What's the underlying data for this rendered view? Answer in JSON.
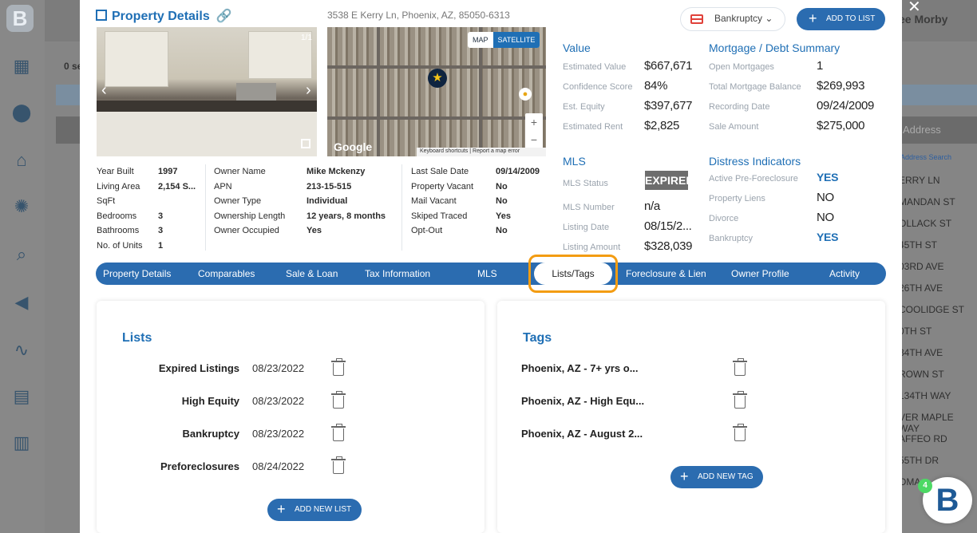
{
  "sidebar": {
    "logo": "B",
    "icons": [
      "grid-icon",
      "location-pin-icon",
      "home-icon",
      "lightbulb-icon",
      "home-search-icon",
      "megaphone-icon",
      "route-icon",
      "chat-icon",
      "bar-chart-icon"
    ]
  },
  "background": {
    "user_name": "ee Morby",
    "count_label": "0 se",
    "address_header": "Address",
    "address_search": "Address Search",
    "streets": [
      "ERRY LN",
      "MANDAN ST",
      "OLLACK ST",
      "45TH ST",
      "03RD AVE",
      "26TH AVE",
      "COOLIDGE ST",
      "0TH ST",
      "34TH AVE",
      "ROWN ST",
      "134TH WAY",
      "VER MAPLE WAY",
      "AFFEO RD",
      "55TH DR",
      "OMA"
    ]
  },
  "modal": {
    "title": "Property Details",
    "address": "3538 E Kerry Ln, Phoenix, AZ, 85050-6313",
    "status_select": "Bankruptcy",
    "add_to_list": "ADD TO LIST",
    "photo_counter": "1/1",
    "map": {
      "map_label": "MAP",
      "satellite_label": "SATELLITE",
      "google": "Google",
      "attribution": "Keyboard shortcuts  |  Report a map error"
    }
  },
  "facts": {
    "col1": [
      [
        "Year Built",
        "1997"
      ],
      [
        "Living Area",
        "2,154 S..."
      ],
      [
        "SqFt",
        ""
      ],
      [
        "Bedrooms",
        "3"
      ],
      [
        "Bathrooms",
        "3"
      ],
      [
        "No. of Units",
        "1"
      ]
    ],
    "col2": [
      [
        "Owner Name",
        "Mike Mckenzy"
      ],
      [
        "APN",
        "213-15-515"
      ],
      [
        "Owner Type",
        "Individual"
      ],
      [
        "Ownership Length",
        "12 years, 8 months"
      ],
      [
        "Owner Occupied",
        "Yes"
      ]
    ],
    "col3": [
      [
        "Last Sale Date",
        "09/14/2009"
      ],
      [
        "Property Vacant",
        "No"
      ],
      [
        "Mail Vacant",
        "No"
      ],
      [
        "Skiped Traced",
        "Yes"
      ],
      [
        "Opt-Out",
        "No"
      ]
    ]
  },
  "value": {
    "heading": "Value",
    "rows": [
      [
        "Estimated Value",
        "$667,671"
      ],
      [
        "Confidence Score",
        "84%"
      ],
      [
        "Est. Equity",
        "$397,677"
      ],
      [
        "Estimated Rent",
        "$2,825"
      ]
    ]
  },
  "mortgage": {
    "heading": "Mortgage / Debt Summary",
    "rows": [
      [
        "Open Mortgages",
        "1"
      ],
      [
        "Total Mortgage Balance",
        "$269,993"
      ],
      [
        "Recording Date",
        "09/24/2009"
      ],
      [
        "Sale Amount",
        "$275,000"
      ]
    ]
  },
  "mls": {
    "heading": "MLS",
    "status_label": "MLS Status",
    "status_value": "EXPIRED",
    "rows": [
      [
        "MLS Number",
        "n/a"
      ],
      [
        "Listing Date",
        "08/15/2..."
      ],
      [
        "Listing Amount",
        "$328,039"
      ]
    ]
  },
  "distress": {
    "heading": "Distress Indicators",
    "rows": [
      [
        "Active Pre-Foreclosure",
        "YES"
      ],
      [
        "Property Liens",
        "NO"
      ],
      [
        "Divorce",
        "NO"
      ],
      [
        "Bankruptcy",
        "YES"
      ]
    ]
  },
  "tabs": [
    "Property Details",
    "Comparables",
    "Sale & Loan",
    "Tax Information",
    "MLS",
    "Lists/Tags",
    "Foreclosure & Lien",
    "Owner Profile",
    "Activity"
  ],
  "active_tab": "Lists/Tags",
  "lists": {
    "heading": "Lists",
    "items": [
      [
        "Expired Listings",
        "08/23/2022"
      ],
      [
        "High Equity",
        "08/23/2022"
      ],
      [
        "Bankruptcy",
        "08/23/2022"
      ],
      [
        "Preforeclosures",
        "08/24/2022"
      ]
    ],
    "add_button": "ADD NEW LIST"
  },
  "tags": {
    "heading": "Tags",
    "items": [
      "Phoenix, AZ - 7+ yrs o...",
      "Phoenix, AZ - High Equ...",
      "Phoenix, AZ - August 2..."
    ],
    "add_button": "ADD NEW TAG"
  },
  "fab": {
    "logo": "B",
    "badge": "4"
  },
  "colors": {
    "brand_blue": "#2b6cb0",
    "active_tab_outline": "#f39c12",
    "heading_blue": "#1f6fb5"
  }
}
